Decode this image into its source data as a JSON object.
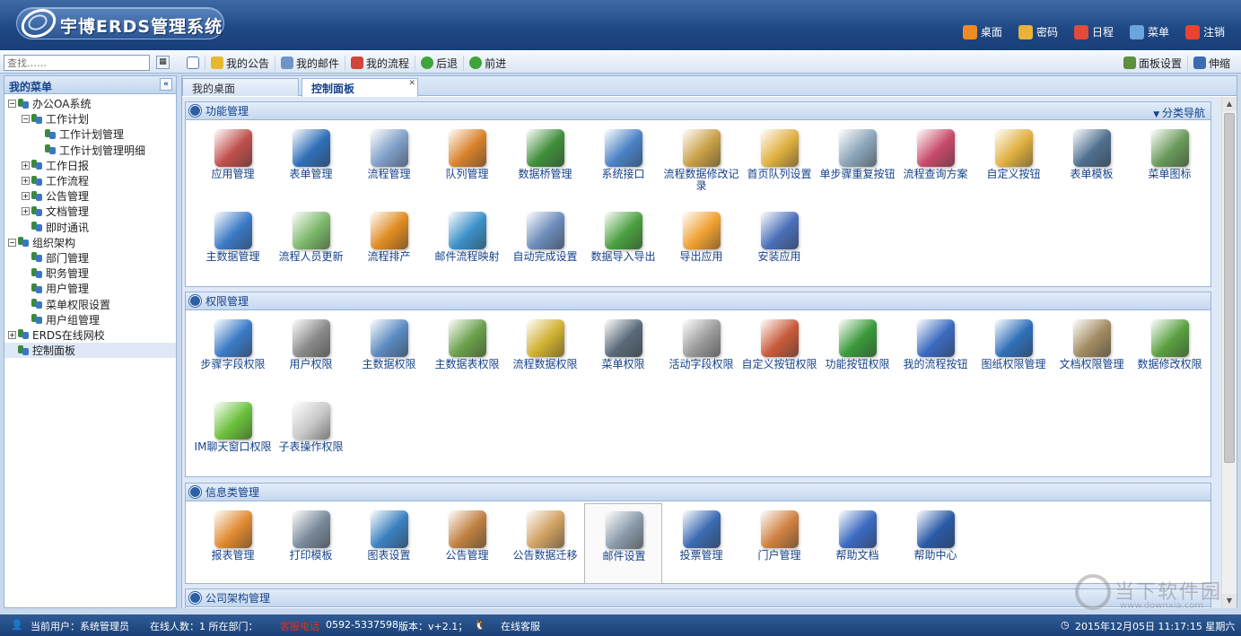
{
  "header": {
    "logo_text": "宇博ERDS管理系统",
    "nav": [
      {
        "label": "桌面",
        "icon": "home-icon",
        "color": "#f08a24"
      },
      {
        "label": "密码",
        "icon": "lock-icon",
        "color": "#e8b23c"
      },
      {
        "label": "日程",
        "icon": "calendar-icon",
        "color": "#e24a3a"
      },
      {
        "label": "菜单",
        "icon": "menu-icon",
        "color": "#6aa5de"
      },
      {
        "label": "注销",
        "icon": "logout-icon",
        "color": "#e8432e"
      }
    ]
  },
  "toolbar": {
    "search_placeholder": "查找……",
    "left": [
      {
        "label": "我的公告",
        "icon": "announcement-icon",
        "color": "#e6b830"
      },
      {
        "label": "我的邮件",
        "icon": "mail-icon",
        "color": "#6f95c8"
      },
      {
        "label": "我的流程",
        "icon": "flow-icon",
        "color": "#d2453a"
      },
      {
        "label": "后退",
        "icon": "back-icon",
        "color": "#3ea53a"
      },
      {
        "label": "前进",
        "icon": "forward-icon",
        "color": "#3ea53a"
      }
    ],
    "right": [
      {
        "label": "面板设置",
        "icon": "panel-settings-icon",
        "color": "#5d8f3c"
      },
      {
        "label": "伸缩",
        "icon": "collapse-icon",
        "color": "#3a6cb0"
      }
    ]
  },
  "sidebar": {
    "title": "我的菜单",
    "items": [
      {
        "label": "办公OA系统",
        "level": 0,
        "toggle": "−"
      },
      {
        "label": "工作计划",
        "level": 1,
        "toggle": "−"
      },
      {
        "label": "工作计划管理",
        "level": 2,
        "toggle": ""
      },
      {
        "label": "工作计划管理明细",
        "level": 2,
        "toggle": ""
      },
      {
        "label": "工作日报",
        "level": 1,
        "toggle": "+"
      },
      {
        "label": "工作流程",
        "level": 1,
        "toggle": "+"
      },
      {
        "label": "公告管理",
        "level": 1,
        "toggle": "+"
      },
      {
        "label": "文档管理",
        "level": 1,
        "toggle": "+"
      },
      {
        "label": "即时通讯",
        "level": 1,
        "toggle": ""
      },
      {
        "label": "组织架构",
        "level": 0,
        "toggle": "−"
      },
      {
        "label": "部门管理",
        "level": 1,
        "toggle": ""
      },
      {
        "label": "职务管理",
        "level": 1,
        "toggle": ""
      },
      {
        "label": "用户管理",
        "level": 1,
        "toggle": ""
      },
      {
        "label": "菜单权限设置",
        "level": 1,
        "toggle": ""
      },
      {
        "label": "用户组管理",
        "level": 1,
        "toggle": ""
      },
      {
        "label": "ERDS在线网校",
        "level": 0,
        "toggle": "+"
      },
      {
        "label": "控制面板",
        "level": 0,
        "toggle": "",
        "selected": true
      }
    ]
  },
  "tabs": [
    {
      "label": "我的桌面",
      "active": false
    },
    {
      "label": "控制面板",
      "active": true
    }
  ],
  "panels": [
    {
      "title": "功能管理",
      "nav": "分类导航",
      "items": [
        {
          "label": "应用管理",
          "color": "#c0504d"
        },
        {
          "label": "表单管理",
          "color": "#2f6fb8"
        },
        {
          "label": "流程管理",
          "color": "#7f9fc8"
        },
        {
          "label": "队列管理",
          "color": "#d9822b"
        },
        {
          "label": "数据桥管理",
          "color": "#3f8f3a"
        },
        {
          "label": "系统接口",
          "color": "#4a82c6"
        },
        {
          "label": "流程数据修改记录",
          "color": "#c9a045"
        },
        {
          "label": "首页队列设置",
          "color": "#e0b040"
        },
        {
          "label": "单步骤重复按钮",
          "color": "#8aa4b8"
        },
        {
          "label": "流程查询方案",
          "color": "#c84a6a"
        },
        {
          "label": "自定义按钮",
          "color": "#e0b040"
        },
        {
          "label": "表单模板",
          "color": "#4f6f8f"
        },
        {
          "label": "菜单图标",
          "color": "#6a9a5a"
        },
        {
          "label": "主数据管理",
          "color": "#3a7ac6"
        },
        {
          "label": "流程人员更新",
          "color": "#7cb86a"
        },
        {
          "label": "流程排产",
          "color": "#e08a20"
        },
        {
          "label": "邮件流程映射",
          "color": "#3a90c8"
        },
        {
          "label": "自动完成设置",
          "color": "#6a8ab8"
        },
        {
          "label": "数据导入导出",
          "color": "#4aa040"
        },
        {
          "label": "导出应用",
          "color": "#f0a030"
        },
        {
          "label": "安装应用",
          "color": "#4a6fb8"
        }
      ]
    },
    {
      "title": "权限管理",
      "nav": "",
      "items": [
        {
          "label": "步骤字段权限",
          "color": "#3a7ac6"
        },
        {
          "label": "用户权限",
          "color": "#8a8a8a"
        },
        {
          "label": "主数据权限",
          "color": "#5a8ac0"
        },
        {
          "label": "主数据表权限",
          "color": "#6aa04a"
        },
        {
          "label": "流程数据权限",
          "color": "#d0b030"
        },
        {
          "label": "菜单权限",
          "color": "#5a6a7a"
        },
        {
          "label": "活动字段权限",
          "color": "#9a9a9a"
        },
        {
          "label": "自定义按钮权限",
          "color": "#c85a3a"
        },
        {
          "label": "功能按钮权限",
          "color": "#3a9a3a"
        },
        {
          "label": "我的流程按钮",
          "color": "#3a6ac0"
        },
        {
          "label": "图纸权限管理",
          "color": "#2f6fb8"
        },
        {
          "label": "文档权限管理",
          "color": "#a08a60"
        },
        {
          "label": "数据修改权限",
          "color": "#5aa040"
        },
        {
          "label": "IM聊天窗口权限",
          "color": "#6ac03a"
        },
        {
          "label": "子表操作权限",
          "color": "#c8c8c8"
        }
      ]
    },
    {
      "title": "信息类管理",
      "nav": "",
      "items": [
        {
          "label": "报表管理",
          "color": "#e08a30"
        },
        {
          "label": "打印模板",
          "color": "#7a8a9a"
        },
        {
          "label": "图表设置",
          "color": "#3a80c0"
        },
        {
          "label": "公告管理",
          "color": "#c08040"
        },
        {
          "label": "公告数据迁移",
          "color": "#d0a060"
        },
        {
          "label": "邮件设置",
          "color": "#8a9aaa",
          "hl": true
        },
        {
          "label": "投票管理",
          "color": "#3a6ab0"
        },
        {
          "label": "门户管理",
          "color": "#d08040"
        },
        {
          "label": "帮助文档",
          "color": "#3a6ac0"
        },
        {
          "label": "帮助中心",
          "color": "#2a5aa8"
        }
      ]
    },
    {
      "title": "公司架构管理",
      "nav": "",
      "items": []
    }
  ],
  "status": {
    "user": "当前用户：系统管理员",
    "online": "在线人数：1  所在部门：",
    "hotline_label": "客服电话",
    "hotline": "0592-5337598",
    "version": "版本：v+2.1；",
    "service": "在线客服",
    "datetime": "2015年12月05日  11:17:15  星期六"
  },
  "watermark": {
    "text": "当下软件园",
    "url": "www.downxia.com"
  }
}
